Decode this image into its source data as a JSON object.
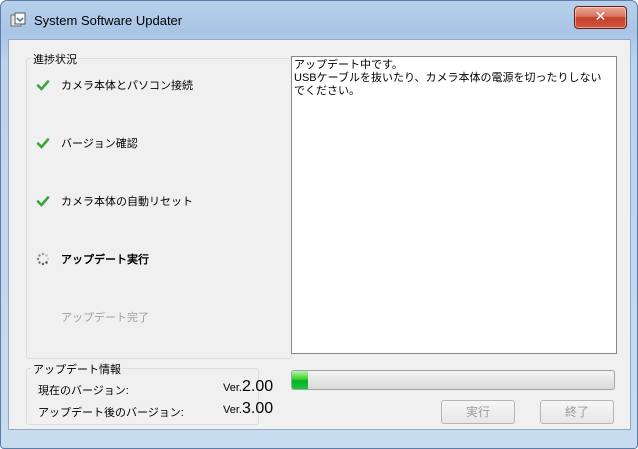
{
  "window": {
    "title": "System Software Updater",
    "close_glyph": "✕"
  },
  "progress_group": {
    "title": "進捗状況",
    "steps": [
      {
        "label": "カメラ本体とパソコン接続",
        "status": "done",
        "icon": "checkmark-icon"
      },
      {
        "label": "バージョン確認",
        "status": "done",
        "icon": "checkmark-icon"
      },
      {
        "label": "カメラ本体の自動リセット",
        "status": "done",
        "icon": "checkmark-icon"
      },
      {
        "label": "アップデート実行",
        "status": "in-progress",
        "icon": "spinner-icon"
      },
      {
        "label": "アップデート完了",
        "status": "pending",
        "icon": ""
      }
    ]
  },
  "log": {
    "text": "アップデート中です。\nUSBケーブルを抜いたり、カメラ本体の電源を切ったりしないでください。"
  },
  "progress_bar": {
    "value_percent": 5
  },
  "buttons": {
    "run": "実行",
    "exit": "終了"
  },
  "info_group": {
    "title": "アップデート情報",
    "current_label": "現在のバージョン:",
    "current_prefix": "Ver.",
    "current_value": "2.00",
    "after_label": "アップデート後のバージョン:",
    "after_prefix": "Ver.",
    "after_value": "3.00"
  },
  "colors": {
    "check": "#3aa53a",
    "accent_green": "#06b025",
    "close": "#c2412a"
  }
}
